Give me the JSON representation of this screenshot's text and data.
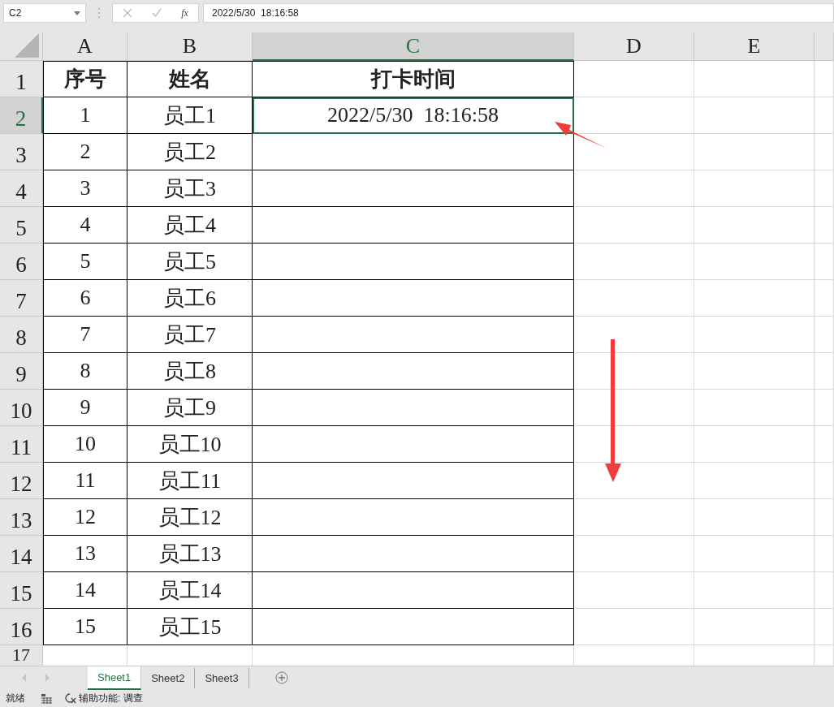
{
  "name_box": {
    "value": "C2"
  },
  "formula_bar": {
    "function_label": "fx",
    "value": "2022/5/30  18:16:58"
  },
  "columns": [
    {
      "label": "A",
      "selected": false
    },
    {
      "label": "B",
      "selected": false
    },
    {
      "label": "C",
      "selected": true
    },
    {
      "label": "D",
      "selected": false
    },
    {
      "label": "E",
      "selected": false
    }
  ],
  "rows": [
    {
      "number": "1",
      "selected": false,
      "kind": "header",
      "cells": [
        "序号",
        "姓名",
        "打卡时间"
      ]
    },
    {
      "number": "2",
      "selected": true,
      "kind": "data",
      "cells": [
        "1",
        "员工1",
        "2022/5/30  18:16:58"
      ]
    },
    {
      "number": "3",
      "selected": false,
      "kind": "data",
      "cells": [
        "2",
        "员工2"
      ]
    },
    {
      "number": "4",
      "selected": false,
      "kind": "data",
      "cells": [
        "3",
        "员工3"
      ]
    },
    {
      "number": "5",
      "selected": false,
      "kind": "data",
      "cells": [
        "4",
        "员工4"
      ]
    },
    {
      "number": "6",
      "selected": false,
      "kind": "data",
      "cells": [
        "5",
        "员工5"
      ]
    },
    {
      "number": "7",
      "selected": false,
      "kind": "data",
      "cells": [
        "6",
        "员工6"
      ]
    },
    {
      "number": "8",
      "selected": false,
      "kind": "data",
      "cells": [
        "7",
        "员工7"
      ]
    },
    {
      "number": "9",
      "selected": false,
      "kind": "data",
      "cells": [
        "8",
        "员工8"
      ]
    },
    {
      "number": "10",
      "selected": false,
      "kind": "data",
      "cells": [
        "9",
        "员工9"
      ]
    },
    {
      "number": "11",
      "selected": false,
      "kind": "data",
      "cells": [
        "10",
        "员工10"
      ]
    },
    {
      "number": "12",
      "selected": false,
      "kind": "data",
      "cells": [
        "11",
        "员工11"
      ]
    },
    {
      "number": "13",
      "selected": false,
      "kind": "data",
      "cells": [
        "12",
        "员工12"
      ]
    },
    {
      "number": "14",
      "selected": false,
      "kind": "data",
      "cells": [
        "13",
        "员工13"
      ]
    },
    {
      "number": "15",
      "selected": false,
      "kind": "data",
      "cells": [
        "14",
        "员工14"
      ]
    },
    {
      "number": "16",
      "selected": false,
      "kind": "data",
      "cells": [
        "15",
        "员工15"
      ]
    },
    {
      "number": "17",
      "selected": false,
      "kind": "empty"
    }
  ],
  "sheet_tabs": [
    {
      "label": "Sheet1",
      "selected": true
    },
    {
      "label": "Sheet2",
      "selected": false
    },
    {
      "label": "Sheet3",
      "selected": false
    }
  ],
  "status_bar": {
    "mode": "就绪",
    "accessibility": "辅助功能: 调查"
  }
}
